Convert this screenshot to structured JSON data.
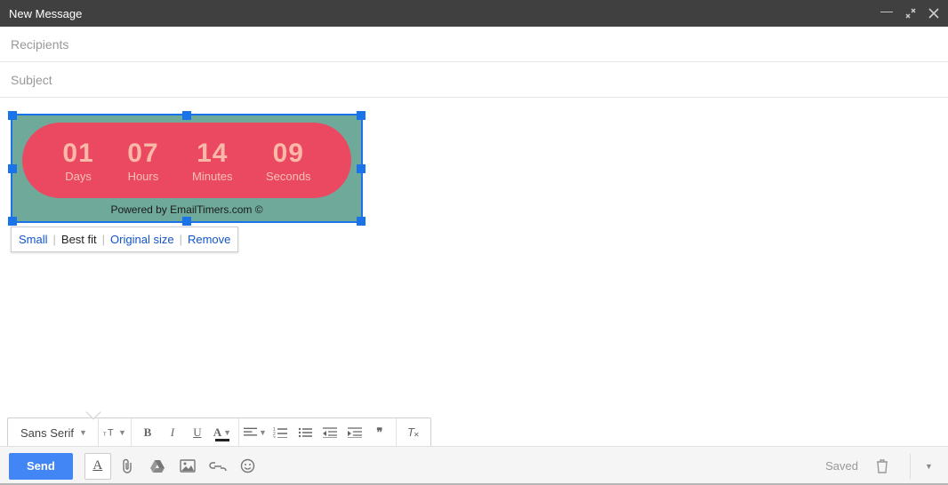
{
  "header": {
    "title": "New Message"
  },
  "fields": {
    "recipients_placeholder": "Recipients",
    "subject_placeholder": "Subject"
  },
  "timer": {
    "segments": [
      {
        "num": "01",
        "label": "Days"
      },
      {
        "num": "07",
        "label": "Hours"
      },
      {
        "num": "14",
        "label": "Minutes"
      },
      {
        "num": "09",
        "label": "Seconds"
      }
    ],
    "powered": "Powered by EmailTimers.com ©"
  },
  "image_toolbar": {
    "small": "Small",
    "best_fit": "Best fit",
    "original": "Original size",
    "remove": "Remove",
    "sep": "|"
  },
  "format": {
    "font": "Sans Serif"
  },
  "sendbar": {
    "send": "Send",
    "saved": "Saved"
  }
}
